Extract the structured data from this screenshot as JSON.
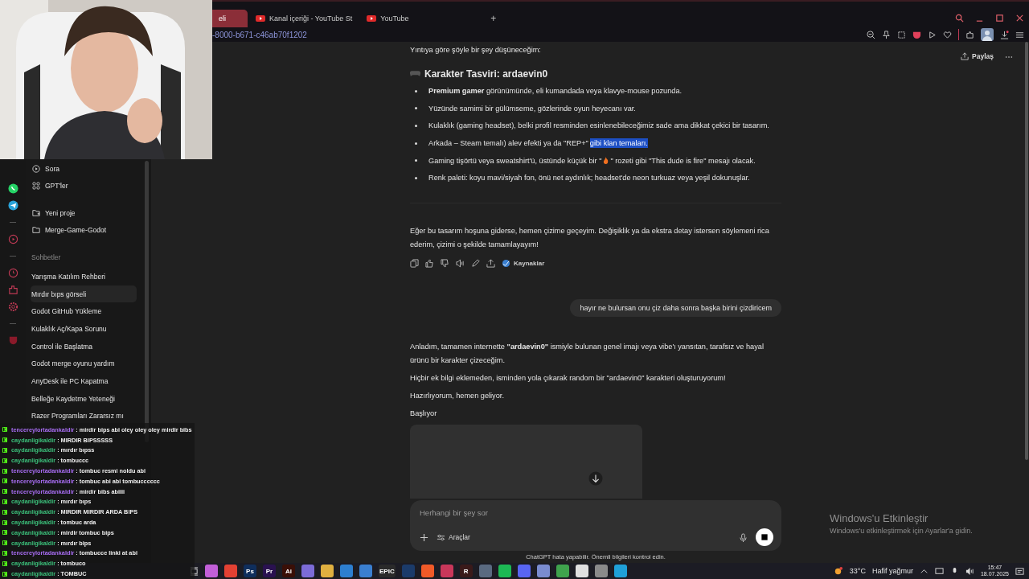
{
  "browser": {
    "tabs": [
      {
        "label": "eli",
        "selected": true
      },
      {
        "label": "Kanal içeriği - YouTube St",
        "selected": false
      },
      {
        "label": "YouTube",
        "selected": false
      }
    ],
    "new_tab": "+",
    "url": "-8000-b671-c46ab70f1202"
  },
  "sidebar": {
    "tools": [
      {
        "kind": "sora",
        "label": "Sora"
      },
      {
        "kind": "gpts",
        "label": "GPT'ler"
      }
    ],
    "projects": [
      {
        "kind": "new",
        "label": "Yeni proje"
      },
      {
        "kind": "folder",
        "label": "Merge-Game-Godot"
      }
    ],
    "section": "Sohbetler",
    "chats": [
      {
        "label": "Yarışma Katılım Rehberi",
        "selected": false
      },
      {
        "label": "Mırdır bıps görseli",
        "selected": true
      },
      {
        "label": "Godot GitHub Yükleme",
        "selected": false
      },
      {
        "label": "Kulaklık Aç/Kapa Sorunu",
        "selected": false
      },
      {
        "label": "Control ile Başlatma",
        "selected": false
      },
      {
        "label": "Godot merge oyunu yardım",
        "selected": false
      },
      {
        "label": "AnyDesk ile PC Kapatma",
        "selected": false
      },
      {
        "label": "Belleğe Kaydetme Yeteneği",
        "selected": false
      },
      {
        "label": "Razer Programları Zararsız mı",
        "selected": false
      }
    ]
  },
  "share": "Paylaş",
  "conversation": {
    "intro": "Yıntıya göre şöyle bir şey düşüneceğim:",
    "heading": "Karakter Tasviri: ardaevin0",
    "bullets": [
      {
        "kind": "plain",
        "text": "**Premium gamer** görünümünde, eli kumandada veya klavye-mouse pozunda."
      },
      {
        "kind": "plain",
        "text": "Yüzünde samimi bir gülümseme, gözlerinde oyun heyecanı var."
      },
      {
        "kind": "plain",
        "text": "Kulaklık (gaming headset), belki profil resminden esinlenebileceğimiz sade ama dikkat çekici bir tasarım."
      },
      {
        "kind": "selection",
        "text": "Arkada – Steam temalı) alev efekti ya da \"REP+\"",
        "selected_text": "gibi klan temaları."
      },
      {
        "kind": "flame",
        "text": "Gaming tişörtü veya sweatshirt'ü, üstünde küçük bir \"",
        "after": "\" rozeti gibi \"This dude is fire\" mesajı olacak."
      },
      {
        "kind": "plain",
        "text": "Renk paleti: koyu mavi/siyah fon, önü net aydınlık; headset'de neon turkuaz veya yeşil dokunuşlar."
      }
    ],
    "closing": "Eğer bu tasarım hoşuna giderse, hemen çizime geçeyim. Değişiklik ya da ekstra detay istersen söylemeni rica ederim, çizimi o şekilde tamamlayayım!",
    "sources": "Kaynaklar",
    "user_message": "hayır ne bulursan onu çiz daha sonra başka birini çizdiricem",
    "reply": [
      "Anladım, tamamen internette **\"ardaevin0\"** ismiyle bulunan genel imajı veya vibe'ı yansıtan, tarafsız ve hayal ürünü bir karakter çizeceğim.",
      "Hiçbir ek bilgi eklemeden, isminden yola çıkarak random bir \"ardaevin0\" karakteri oluşturuyorum!",
      "Hazırlıyorum, hemen geliyor.",
      "Başlıyor"
    ]
  },
  "composer": {
    "placeholder": "Herhangi bir şey sor",
    "tools": "Araçlar"
  },
  "disclaimer": "ChatGPT hata yapabilir. Önemli bilgileri kontrol edin.",
  "chat_overlay": [
    {
      "user": "tencereylortadankaldir",
      "color": "#a66cf0",
      "message": ": mirdir bips abi oley oley oley mirdir bibs"
    },
    {
      "user": "caydanligikaldir",
      "color": "#3bbf7a",
      "message": ": MIRDIR BIPSSSSS"
    },
    {
      "user": "caydanligikaldir",
      "color": "#3bbf7a",
      "message": ": mırdır bıpss"
    },
    {
      "user": "caydanligikaldir",
      "color": "#3bbf7a",
      "message": ": tombuccc"
    },
    {
      "user": "tencereylortadankaldir",
      "color": "#a66cf0",
      "message": ": tombuc resmi noldu abi"
    },
    {
      "user": "tencereylortadankaldir",
      "color": "#a66cf0",
      "message": ": tombuc abi abi tombucccccc"
    },
    {
      "user": "tencereylortadankaldir",
      "color": "#a66cf0",
      "message": ": mirdir bibs abiiii"
    },
    {
      "user": "caydanligikaldir",
      "color": "#3bbf7a",
      "message": ": mırdır bıps"
    },
    {
      "user": "caydanligikaldir",
      "color": "#3bbf7a",
      "message": ": MIRDIR MIRDIR ARDA BIPS"
    },
    {
      "user": "caydanligikaldir",
      "color": "#3bbf7a",
      "message": ": tombuc arda"
    },
    {
      "user": "caydanligikaldir",
      "color": "#3bbf7a",
      "message": ": mirdir tombuc bips"
    },
    {
      "user": "caydanligikaldir",
      "color": "#3bbf7a",
      "message": ": mırdır bips"
    },
    {
      "user": "tencereylortadankaldir",
      "color": "#a66cf0",
      "message": ": tombucce linki at abi"
    },
    {
      "user": "caydanligikaldir",
      "color": "#3bbf7a",
      "message": ": tombuco"
    },
    {
      "user": "caydanligikaldir",
      "color": "#3bbf7a",
      "message": ": TOMBUC"
    }
  ],
  "activation": {
    "title": "Windows'u Etkinleştir",
    "text": "Windows'u etkinleştirmek için Ayarlar'a gidin."
  },
  "taskbar": {
    "apps": [
      {
        "color": "#c25fd8"
      },
      {
        "color": "#e34133"
      },
      {
        "color": "#0f2e5c",
        "label": "Ps"
      },
      {
        "color": "#2a1150",
        "label": "Pr"
      },
      {
        "color": "#3a0f07",
        "label": "Ai"
      },
      {
        "color": "#7c6cd8"
      },
      {
        "color": "#e0b040"
      },
      {
        "color": "#2d7fd0"
      },
      {
        "color": "#3a7fd0"
      },
      {
        "color": "#2a2a2a",
        "label": "EPIC"
      },
      {
        "color": "#1b3b6a"
      },
      {
        "color": "#f05a28"
      },
      {
        "color": "#c8375a"
      },
      {
        "color": "#3a1a1a",
        "label": "R"
      },
      {
        "color": "#5a6a80"
      },
      {
        "color": "#1db954"
      },
      {
        "color": "#5865f2"
      },
      {
        "color": "#7a8cd0"
      },
      {
        "color": "#3fa34d"
      },
      {
        "color": "#e0e0e0"
      },
      {
        "color": "#8a8a8a"
      },
      {
        "color": "#1fa0d8"
      }
    ],
    "weather": "33°C",
    "weather_text": "Hafif yağmur",
    "time": "15:47",
    "date": "18.07.2025"
  }
}
